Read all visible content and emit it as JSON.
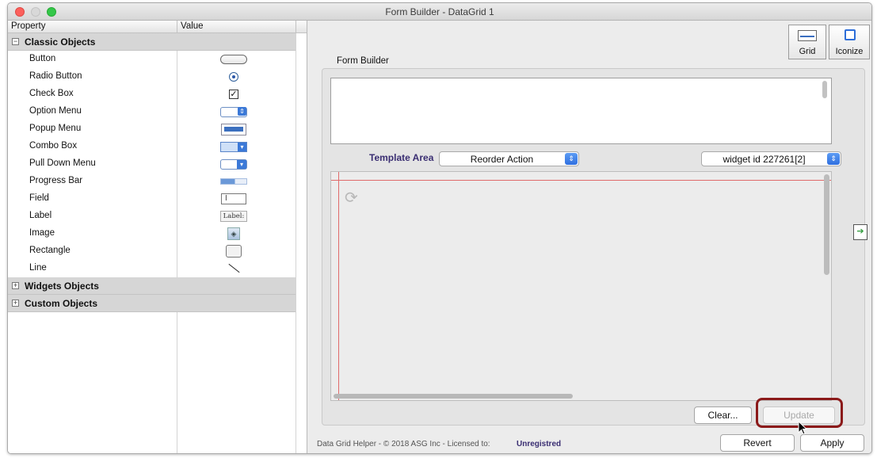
{
  "window": {
    "title": "Form Builder - DataGrid 1"
  },
  "property_panel": {
    "headers": {
      "property": "Property",
      "value": "Value"
    },
    "groups": [
      {
        "label": "Classic Objects",
        "toggle": "−"
      },
      {
        "label": "Widgets Objects",
        "toggle": "+"
      },
      {
        "label": "Custom Objects",
        "toggle": "+"
      }
    ],
    "classic_items": [
      {
        "label": "Button",
        "icon": "button-preview-icon"
      },
      {
        "label": "Radio Button",
        "icon": "radio-button-preview-icon"
      },
      {
        "label": "Check Box",
        "icon": "check-box-preview-icon"
      },
      {
        "label": "Option Menu",
        "icon": "option-menu-preview-icon"
      },
      {
        "label": "Popup Menu",
        "icon": "popup-menu-preview-icon"
      },
      {
        "label": "Combo Box",
        "icon": "combo-box-preview-icon"
      },
      {
        "label": "Pull Down Menu",
        "icon": "pull-down-menu-preview-icon"
      },
      {
        "label": "Progress Bar",
        "icon": "progress-bar-preview-icon"
      },
      {
        "label": "Field",
        "icon": "field-preview-icon"
      },
      {
        "label": "Label",
        "icon": "label-preview-icon",
        "icon_text": "Label:"
      },
      {
        "label": "Image",
        "icon": "image-preview-icon"
      },
      {
        "label": "Rectangle",
        "icon": "rectangle-preview-icon"
      },
      {
        "label": "Line",
        "icon": "line-preview-icon"
      }
    ]
  },
  "toolbar": {
    "grid_label": "Grid",
    "iconize_label": "Iconize"
  },
  "form_builder": {
    "title": "Form Builder",
    "template_area_label": "Template Area",
    "reorder_select": "Reorder Action",
    "widget_select": "widget id 227261[2]"
  },
  "buttons": {
    "clear": "Clear...",
    "update": "Update",
    "revert": "Revert",
    "apply": "Apply"
  },
  "footer": {
    "copyright": "Data Grid Helper - © 2018 ASG Inc - Licensed to:",
    "license": "Unregistred"
  },
  "colors": {
    "accent_blue": "#2f6fe0",
    "highlight_ring": "#8b1a1a",
    "template_label": "#3a2e72",
    "guide_line": "#e06b6b"
  }
}
